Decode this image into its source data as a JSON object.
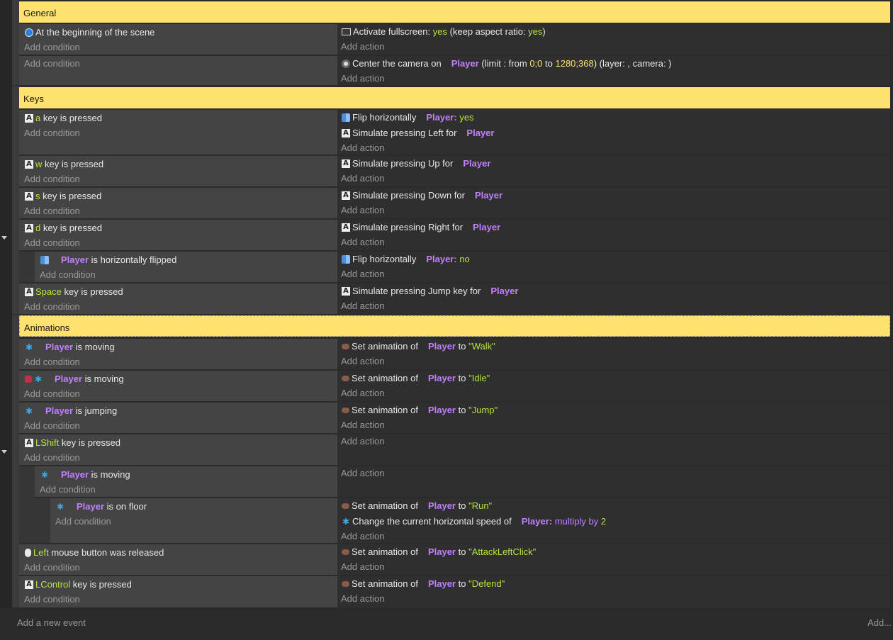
{
  "groups": {
    "general": "General",
    "keys": "Keys",
    "animations": "Animations"
  },
  "common": {
    "add_condition": "Add condition",
    "add_action": "Add action",
    "player": "Player",
    "player_colon": "Player:",
    "key_is_pressed": "key is pressed"
  },
  "events": {
    "scene_start": {
      "condition": "At the beginning of the scene",
      "fullscreen_label": "Activate fullscreen:",
      "fullscreen_value": "yes",
      "aspect_label": "(keep aspect ratio:",
      "aspect_value": "yes",
      "aspect_close": ")"
    },
    "camera": {
      "label": "Center the camera on",
      "limit_label": "(limit : from",
      "from_value": "0;0",
      "to_label": "to",
      "to_value": "1280;368",
      "layer_text": ") (layer: , camera: )"
    },
    "key_a": {
      "key": "a",
      "flip_label": "Flip horizontally",
      "flip_value": "yes",
      "simulate": "Simulate pressing Left for"
    },
    "key_w": {
      "key": "w",
      "simulate": "Simulate pressing Up for"
    },
    "key_s": {
      "key": "s",
      "simulate": "Simulate pressing Down for"
    },
    "key_d": {
      "key": "d",
      "simulate": "Simulate pressing Right for"
    },
    "flipped": {
      "condition": "is horizontally flipped",
      "flip_label": "Flip horizontally",
      "flip_value": "no"
    },
    "key_space": {
      "key": "Space",
      "simulate": "Simulate pressing Jump key for"
    },
    "moving": {
      "condition": "is moving",
      "action": "Set animation of",
      "to": "to",
      "value": "\"Walk\""
    },
    "not_moving": {
      "condition": "is moving",
      "action": "Set animation of",
      "to": "to",
      "value": "\"Idle\""
    },
    "jumping": {
      "condition": "is jumping",
      "action": "Set animation of",
      "to": "to",
      "value": "\"Jump\""
    },
    "lshift": {
      "key": "LShift"
    },
    "lshift_moving": {
      "condition": "is moving"
    },
    "on_floor": {
      "condition": "is on floor",
      "action": "Set animation of",
      "to": "to",
      "value": "\"Run\"",
      "speed_label": "Change the current horizontal speed of",
      "multiply": "multiply by",
      "factor": "2"
    },
    "left_mouse": {
      "key": "Left",
      "condition": "mouse button was released",
      "action": "Set animation of",
      "to": "to",
      "value": "\"AttackLeftClick\""
    },
    "lcontrol": {
      "key": "LControl",
      "action": "Set animation of",
      "to": "to",
      "value": "\"Defend\""
    }
  },
  "footer": {
    "add_event": "Add a new event",
    "add_menu": "Add..."
  },
  "icons": [
    "key-icon",
    "scene-start-icon",
    "fullscreen-icon",
    "camera-icon",
    "flip-icon",
    "animation-icon",
    "platformer-icon",
    "inverted-icon",
    "mouse-icon",
    "fold-arrow-icon"
  ],
  "colors": {
    "group_header": "#ffe170",
    "object_name": "#c080ff",
    "parameter": "#b6e340",
    "condition_bg": "#444444",
    "action_bg": "#2f2f2f"
  }
}
